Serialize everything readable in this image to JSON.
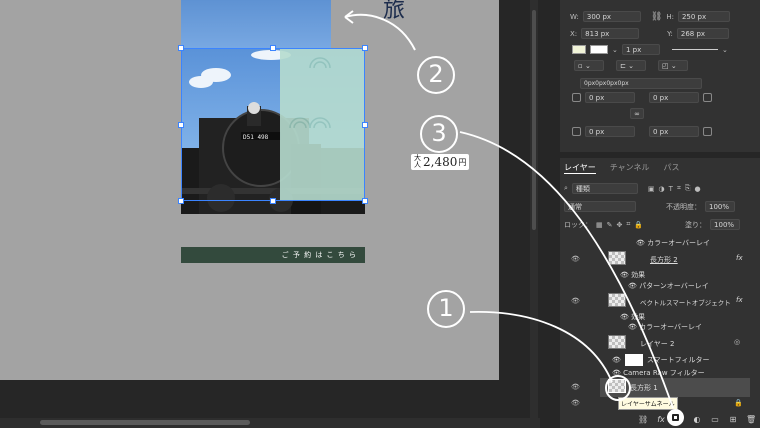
{
  "canvas": {
    "title_glyph": "旅",
    "price": {
      "prefix_top": "大",
      "prefix_bottom": "人",
      "amount": "2,480",
      "unit": "円"
    },
    "banner_text": "ご 予 約 は こ ち ら",
    "train_plate": "D51 498"
  },
  "annotations": {
    "circle_1": "1",
    "circle_2": "2",
    "circle_3": "3"
  },
  "properties": {
    "w_label": "W:",
    "w_value": "300 px",
    "h_label": "H:",
    "h_value": "250 px",
    "x_label": "X:",
    "x_value": "813 px",
    "y_label": "Y:",
    "y_value": "268 px",
    "stroke_width": "1 px",
    "corner_all": "0px0px0px0px",
    "corner_tl": "0 px",
    "corner_tr": "0 px",
    "corner_bl": "0 px",
    "corner_br": "0 px"
  },
  "layers_panel": {
    "tabs": [
      "レイヤー",
      "チャンネル",
      "パス"
    ],
    "active_tab": "レイヤー",
    "filter_kind": "種類",
    "blend_mode": "通常",
    "opacity_label": "不透明度：",
    "opacity_value": "100%",
    "lock_label": "ロック：",
    "fill_label": "塗り：",
    "fill_value": "100%",
    "rows": [
      {
        "name": "カラーオーバーレイ",
        "kind": "effect"
      },
      {
        "name": "長方形 2",
        "kind": "layer",
        "fx": "fx"
      },
      {
        "name": "効果",
        "kind": "effects-header"
      },
      {
        "name": "パターンオーバーレイ",
        "kind": "effect"
      },
      {
        "name": "ベクトルスマートオブジェクト",
        "kind": "layer",
        "fx": "fx"
      },
      {
        "name": "効果",
        "kind": "effects-header"
      },
      {
        "name": "カラーオーバーレイ",
        "kind": "effect"
      },
      {
        "name": "レイヤー 2",
        "kind": "layer"
      },
      {
        "name": "スマートフィルター",
        "kind": "filter"
      },
      {
        "name": "Camera Raw フィルター",
        "kind": "filter"
      },
      {
        "name": "長方形 1",
        "kind": "layer"
      }
    ],
    "tooltip": "レイヤーサムネール",
    "bottom_icons": [
      "link-icon",
      "fx-icon",
      "mask-icon",
      "adjustment-icon",
      "folder-icon",
      "new-layer-icon",
      "trash-icon"
    ],
    "fx_label": "fx"
  },
  "colors": {
    "accent_blue": "#3b84ff",
    "banner_green": "#334a3d",
    "panel_bg": "#323232",
    "canvas_bg": "#a3a3a3"
  }
}
